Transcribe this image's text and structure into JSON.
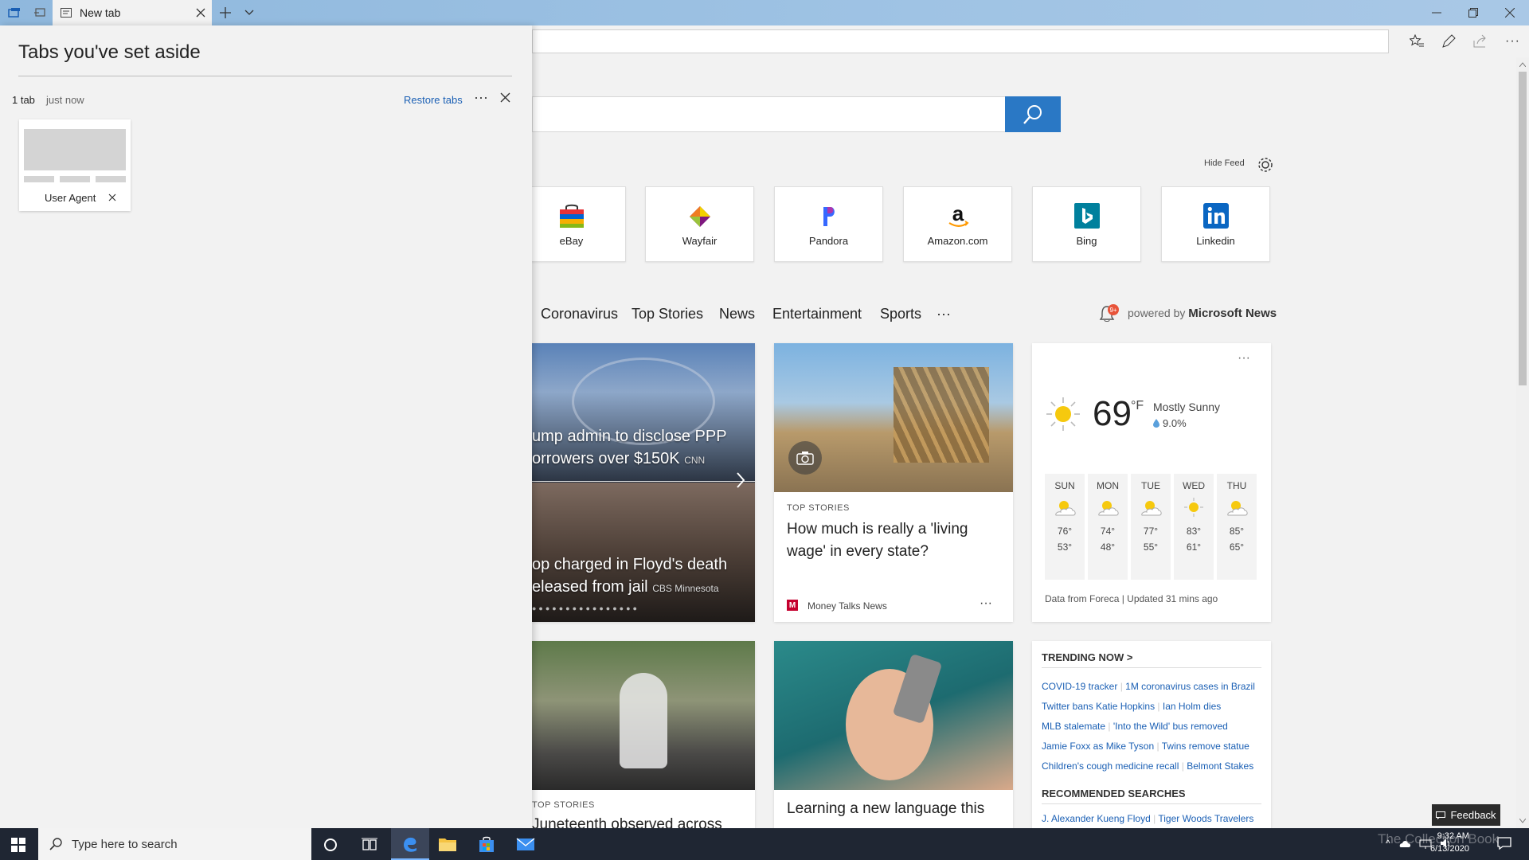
{
  "browser": {
    "tab_title": "New tab",
    "window_controls": [
      "minimize-icon",
      "restore-icon",
      "close-icon"
    ],
    "toolbar_icons": [
      "favorites-icon",
      "pen-icon",
      "share-icon",
      "more-icon"
    ]
  },
  "aside": {
    "title": "Tabs you've set aside",
    "count": "1 tab",
    "time": "just now",
    "restore_label": "Restore tabs",
    "more": "···",
    "thumb_label": "User Agent"
  },
  "newtab": {
    "hide_feed": "Hide Feed",
    "sites": [
      {
        "label": "eBay",
        "icon": "ebay-bag-icon"
      },
      {
        "label": "Wayfair",
        "icon": "wayfair-icon"
      },
      {
        "label": "Pandora",
        "icon": "pandora-icon"
      },
      {
        "label": "Amazon.com",
        "icon": "amazon-icon"
      },
      {
        "label": "Bing",
        "icon": "bing-icon"
      },
      {
        "label": "Linkedin",
        "icon": "linkedin-icon"
      }
    ],
    "feed_tabs": [
      "Coronavirus",
      "Top Stories",
      "News",
      "Entertainment",
      "Sports",
      "···"
    ],
    "bell_badge": "9+",
    "powered_prefix": "powered by",
    "powered_brand": "Microsoft News"
  },
  "stories": {
    "carousel_1_headline_l1": "ump admin to disclose PPP",
    "carousel_1_headline_l2": "orrowers over $150K",
    "carousel_1_source": "CNN",
    "carousel_2_headline_l1": "op charged in Floyd's death",
    "carousel_2_headline_l2": "eleased from jail",
    "carousel_2_source": "CBS Minnesota",
    "card2_category": "TOP STORIES",
    "card2_title_l1": "How much is really a 'living",
    "card2_title_l2": "wage' in every state?",
    "card2_source": "Money Talks News",
    "card4_category": "TOP STORIES",
    "card4_title": "Juneteenth observed across",
    "card5_title": "Learning a new language this"
  },
  "weather": {
    "temp": "69",
    "unit": "°F",
    "condition": "Mostly Sunny",
    "precip": "9.0%",
    "days": [
      {
        "name": "SUN",
        "hi": "76°",
        "lo": "53°"
      },
      {
        "name": "MON",
        "hi": "74°",
        "lo": "48°"
      },
      {
        "name": "TUE",
        "hi": "77°",
        "lo": "55°"
      },
      {
        "name": "WED",
        "hi": "83°",
        "lo": "61°"
      },
      {
        "name": "THU",
        "hi": "85°",
        "lo": "65°"
      }
    ],
    "footer": "Data from Foreca | Updated 31 mins ago"
  },
  "trending": {
    "heading": "TRENDING NOW >",
    "rows": [
      [
        "COVID-19 tracker",
        "1M coronavirus cases in Brazil"
      ],
      [
        "Twitter bans Katie Hopkins",
        "Ian Holm dies"
      ],
      [
        "MLB stalemate",
        "'Into the Wild' bus removed"
      ],
      [
        "Jamie Foxx as Mike Tyson",
        "Twins remove statue"
      ],
      [
        "Children's cough medicine recall",
        "Belmont Stakes"
      ]
    ],
    "recommended_heading": "RECOMMENDED SEARCHES",
    "recommended": [
      "J. Alexander Kueng Floyd",
      "Tiger Woods Travelers"
    ]
  },
  "taskbar": {
    "search_placeholder": "Type here to search",
    "time": "9:32 AM",
    "date": "6/13/2020",
    "feedback": "Feedback",
    "watermark": "The Collection Book"
  },
  "colors": {
    "accent": "#2a78c5",
    "link": "#1a5fb4",
    "taskbar": "#1f2633"
  }
}
